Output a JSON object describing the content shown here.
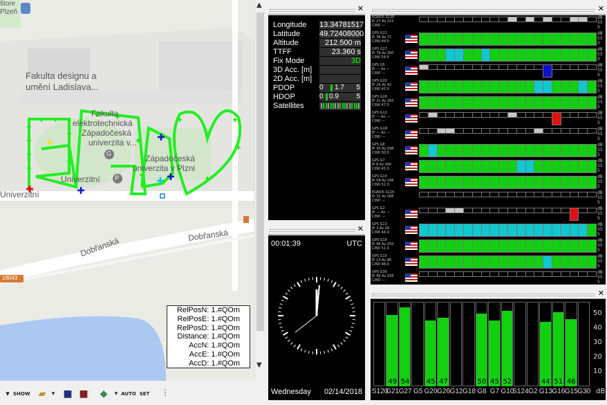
{
  "map": {
    "labels": {
      "top_partial": "štore",
      "top_partial2": "Plzeň",
      "faculty_design": "Fakulta designu a",
      "faculty_design2": "umění Ladislava...",
      "faculty_elec1": "Fakulta",
      "faculty_elec2": "elektrotechnická",
      "faculty_elec3": "Západočeská",
      "faculty_elec4": "univerzita v...",
      "zcu1": "Západočeská",
      "zcu2": "univerzita v Plzni",
      "univerzitni_poi": "Univerzitní",
      "street_univerzitni": "Univerzitní",
      "street_dobranska1": "Dobřanská",
      "street_dobranska2": "Dobřanská",
      "road_number": "18043",
      "poi_g": "G",
      "poi_p": "P"
    },
    "relpos": [
      "RelPosN: 1.#QOm",
      "RelPosE: 1.#QOm",
      "RelPosD: 1.#QOm",
      "Distance: 1.#QOm",
      "AccN: 1.#QOm",
      "AccE: 1.#QOm",
      "AccD: 1.#QOm"
    ]
  },
  "toolbar": {
    "show_label": "SHOW",
    "auto_label": "AUTO",
    "set_label": "SET"
  },
  "info": {
    "rows": [
      {
        "label": "Longitude",
        "value": "13.34781517 °"
      },
      {
        "label": "Latitude",
        "value": "49.72408000 °"
      },
      {
        "label": "Altitude",
        "value": "212.500 m"
      },
      {
        "label": "TTFF",
        "value": "23.360 s"
      },
      {
        "label": "Fix Mode",
        "value": "3D"
      },
      {
        "label": "3D Acc. [m]",
        "value": ""
      },
      {
        "label": "2D Acc. [m]",
        "value": ""
      },
      {
        "label": "PDOP",
        "value": "0 1.7 5"
      },
      {
        "label": "HDOP",
        "value": "0 0.9 5"
      },
      {
        "label": "Satellites",
        "value": ""
      }
    ],
    "fix_color": "#00ff00",
    "pdop": {
      "min": "0",
      "val": "1.7",
      "max": "5",
      "fraction": 0.34
    },
    "hdop": {
      "min": "0",
      "val": "0.9",
      "max": "5",
      "fraction": 0.18
    }
  },
  "clock": {
    "time": "00:01:39",
    "zone": "UTC",
    "day": "Wednesday",
    "date": "02/14/2018"
  },
  "satellites": [
    {
      "name": "EGNOS S120",
      "line2": "El 27 Az 215",
      "line3": "C/N0 ---",
      "flag": false,
      "cells": "eeeeeeeeeegegegeegge"
    },
    {
      "name": "GPS G21",
      "line2": "El 36 Az 71",
      "line3": "C/N0 49.0",
      "flag": true,
      "cells": "GGGGGGGGGGGGGGGGGGGG"
    },
    {
      "name": "GPS G27",
      "line2": "El 78 Az 300",
      "line3": "C/N0 54.0",
      "flag": true,
      "cells": "GGGCCGGCGGGGGGGGGGGG"
    },
    {
      "name": "GPS G5",
      "line2": "El --- Az ---",
      "line3": "C/N0 ---",
      "flag": true,
      "cells": "geeeeeeeeeeeeeBeeeee"
    },
    {
      "name": "GPS G20",
      "line2": "El 16 Az 42",
      "line3": "C/N0 45.0",
      "flag": true,
      "cells": "GGGGGGGGGGGGGCCGGGCG"
    },
    {
      "name": "GPS G26",
      "line2": "El 21 Az 184",
      "line3": "C/N0 47.0",
      "flag": true,
      "cells": "GGGGGGGGGGGGGGGGGGGG"
    },
    {
      "name": "GPS G12",
      "line2": "El --- Az ---",
      "line3": "C/N0 ---",
      "flag": true,
      "cells": "egeeeeeeeegeeeeReeee"
    },
    {
      "name": "GPS G18",
      "line2": "El --- Az ---",
      "line3": "C/N0 ---",
      "flag": true,
      "cells": "eeggeeeeeeeeegeeeeee"
    },
    {
      "name": "GPS G8",
      "line2": "El 30 Az 298",
      "line3": "C/N0 50.0",
      "flag": true,
      "cells": "GCGGGGGGGGGGGGGGGGGG"
    },
    {
      "name": "GPS G7",
      "line2": "El 8 Az 300",
      "line3": "C/N0 45.0",
      "flag": true,
      "cells": "GGGGGGGGGGGCCGGGGGGG"
    },
    {
      "name": "GPS G10",
      "line2": "El 58 Az 148",
      "line3": "C/N0 52.0",
      "flag": true,
      "cells": "GGGGGGGGGGGGGGGGGGGG"
    },
    {
      "name": "EGNOS S124",
      "line2": "El 32 Az 168",
      "line3": "C/N0 ---",
      "flag": false,
      "cells": "eeeeeeeeeeeeeeeeeeee"
    },
    {
      "name": "GPS G2",
      "line2": "El --- Az ---",
      "line3": "C/N0 ---",
      "flag": true,
      "cells": "eeeggeeeeeeeeeeeeRee"
    },
    {
      "name": "GPS G13",
      "line2": "El 3 Az 18",
      "line3": "C/N0 44.0",
      "flag": true,
      "cells": "CCCCCCCCCCCCCCCCCCCG"
    },
    {
      "name": "GPS G16",
      "line2": "El 46 Az 204",
      "line3": "C/N0 51.0",
      "flag": true,
      "cells": "GGGGGGGGGGGGGGGGGGGG"
    },
    {
      "name": "GPS G15",
      "line2": "El 13 Az 46",
      "line3": "C/N0 46.0",
      "flag": true,
      "cells": "GGGGGGGGGGGGGGCGGGGG"
    },
    {
      "name": "GPS G30",
      "line2": "El 46 Az 328",
      "line3": "C/N0 ---",
      "flag": true,
      "cells": "eeeeeeeeeeeeeeeeeeee"
    }
  ],
  "snr": {
    "bars": [
      {
        "label": "S120",
        "value": null,
        "shown": ""
      },
      {
        "label": "G21",
        "value": 49,
        "shown": "49"
      },
      {
        "label": "G27",
        "value": 54,
        "shown": "54"
      },
      {
        "label": "G5",
        "value": null,
        "shown": ""
      },
      {
        "label": "G20",
        "value": 45,
        "shown": "45"
      },
      {
        "label": "G26",
        "value": 47,
        "shown": "47"
      },
      {
        "label": "G12",
        "value": null,
        "shown": ""
      },
      {
        "label": "G18",
        "value": null,
        "shown": ""
      },
      {
        "label": "G8",
        "value": 50,
        "shown": "50"
      },
      {
        "label": "G7",
        "value": 45,
        "shown": "45"
      },
      {
        "label": "G10",
        "value": 52,
        "shown": "52"
      },
      {
        "label": "S124",
        "value": null,
        "shown": ""
      },
      {
        "label": "G2",
        "value": null,
        "shown": ""
      },
      {
        "label": "G13",
        "value": 44,
        "shown": "44"
      },
      {
        "label": "G16",
        "value": 51,
        "shown": "51"
      },
      {
        "label": "G15",
        "value": 46,
        "shown": "46"
      },
      {
        "label": "G30",
        "value": null,
        "shown": ""
      }
    ],
    "ticks": [
      "50",
      "40",
      "30",
      "20",
      "10"
    ],
    "unit": "dB",
    "ymax": 58
  },
  "colors": {
    "green": "#10d010",
    "cyan": "#10c8d0",
    "red": "#e01010",
    "blue": "#1010d0",
    "grey": "#c8c8c8",
    "track": "#22ee22"
  }
}
